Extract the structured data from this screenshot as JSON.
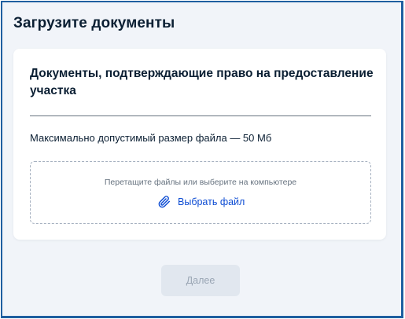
{
  "page": {
    "title": "Загрузите документы"
  },
  "upload_card": {
    "title": "Документы, подтверждающие право на предоставление участка",
    "size_note": "Максимально допустимый размер файла — 50 Мб",
    "dropzone": {
      "hint": "Перетащите файлы или выберите на компьютере",
      "choose_label": "Выбрать файл",
      "icon": "paperclip-icon"
    }
  },
  "footer": {
    "next_label": "Далее",
    "next_disabled": true
  },
  "colors": {
    "frame_border": "#1f5fa0",
    "background": "#f1f4f9",
    "link": "#0d4cd3",
    "text": "#0b1f33",
    "disabled_button_bg": "#e1e7ef",
    "disabled_button_text": "#9aa6b4"
  }
}
